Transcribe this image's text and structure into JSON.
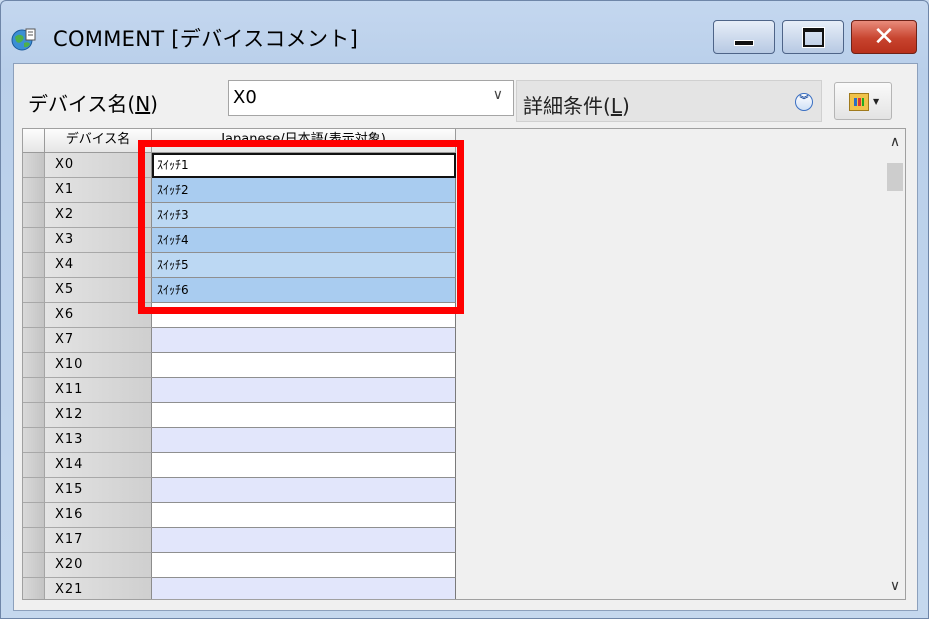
{
  "window": {
    "title": "COMMENT [デバイスコメント]",
    "icon": "app-globe-icon",
    "controls": {
      "minimize": "minimize-icon",
      "maximize": "maximize-icon",
      "close": "close-icon",
      "close_glyph": "✕"
    }
  },
  "toolbar": {
    "device_label": "デバイス名(",
    "device_label_key": "N",
    "device_label_end": ")",
    "device_value": "X0",
    "combo_arrow": "∨",
    "detail_label": "詳細条件(",
    "detail_label_key": "L",
    "detail_label_end": ")",
    "detail_icon": "double-chevron-down-icon",
    "tool_icon": "chart-folder-icon"
  },
  "grid": {
    "headers": {
      "device": "デバイス名",
      "comment": "Japanese/日本語(表示対象)"
    },
    "rows": [
      {
        "device": "X0",
        "comment": "ｽｲｯﾁ1"
      },
      {
        "device": "X1",
        "comment": "ｽｲｯﾁ2"
      },
      {
        "device": "X2",
        "comment": "ｽｲｯﾁ3"
      },
      {
        "device": "X3",
        "comment": "ｽｲｯﾁ4"
      },
      {
        "device": "X4",
        "comment": "ｽｲｯﾁ5"
      },
      {
        "device": "X5",
        "comment": "ｽｲｯﾁ6"
      },
      {
        "device": "X6",
        "comment": ""
      },
      {
        "device": "X7",
        "comment": ""
      },
      {
        "device": "X10",
        "comment": ""
      },
      {
        "device": "X11",
        "comment": ""
      },
      {
        "device": "X12",
        "comment": ""
      },
      {
        "device": "X13",
        "comment": ""
      },
      {
        "device": "X14",
        "comment": ""
      },
      {
        "device": "X15",
        "comment": ""
      },
      {
        "device": "X16",
        "comment": ""
      },
      {
        "device": "X17",
        "comment": ""
      },
      {
        "device": "X20",
        "comment": ""
      },
      {
        "device": "X21",
        "comment": ""
      }
    ]
  },
  "scrollbar": {
    "up_glyph": "∧",
    "down_glyph": "∨"
  },
  "colors": {
    "highlight": "#ff0000",
    "selection": "#a9ccf0",
    "alt_row": "#e2e6fb"
  }
}
